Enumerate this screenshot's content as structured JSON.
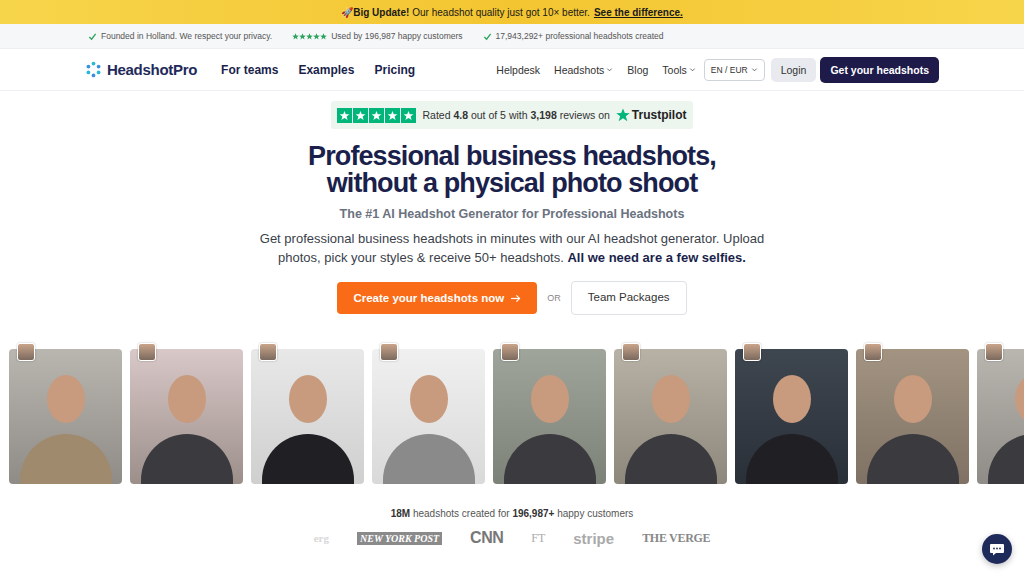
{
  "announcement": {
    "icon": "🚀",
    "bold": "Big Update!",
    "text": "Our headshot quality just got 10× better.",
    "link": "See the difference."
  },
  "trust_bar": [
    {
      "kind": "check",
      "text": "Founded in Holland. We respect your privacy."
    },
    {
      "kind": "stars",
      "stars": 5,
      "text": "Used by 196,987 happy customers"
    },
    {
      "kind": "check",
      "text": "17,943,292+ professional headshots created"
    }
  ],
  "nav": {
    "logo": "HeadshotPro",
    "primary": [
      "For teams",
      "Examples",
      "Pricing"
    ],
    "secondary": [
      {
        "label": "Helpdesk",
        "dropdown": false
      },
      {
        "label": "Headshots",
        "dropdown": true
      },
      {
        "label": "Blog",
        "dropdown": false
      },
      {
        "label": "Tools",
        "dropdown": true
      }
    ],
    "locale": "EN / EUR",
    "login": "Login",
    "cta": "Get your headshots"
  },
  "rating": {
    "stars": 5,
    "prefix": "Rated",
    "score": "4.8",
    "middle": "out of 5 with",
    "count": "3,198",
    "suffix": "reviews on",
    "brand": "Trustpilot"
  },
  "hero": {
    "title": [
      "Professional business headshots,",
      "without a physical photo shoot"
    ],
    "subtitle": "The #1 AI Headshot Generator for Professional Headshots",
    "description": "Get professional business headshots in minutes with our AI headshot generator. Upload photos, pick your styles & receive 50+ headshots.",
    "description_bold": "All we need are a few selfies.",
    "cta_primary": "Create your headshots now",
    "or": "OR",
    "cta_secondary": "Team Packages"
  },
  "gallery": [
    {
      "selfie": true
    },
    {
      "selfie": true
    },
    {
      "selfie": true
    },
    {
      "selfie": true
    },
    {
      "selfie": true
    },
    {
      "selfie": true
    },
    {
      "selfie": true
    },
    {
      "selfie": true
    },
    {
      "selfie": true
    }
  ],
  "stats": {
    "count": "18M",
    "middle": "headshots created for",
    "customers": "196,987+",
    "suffix": "happy customers"
  },
  "press": [
    "erg",
    "NEW YORK POST",
    "CNN",
    "FT",
    "stripe",
    "THE VERGE"
  ]
}
